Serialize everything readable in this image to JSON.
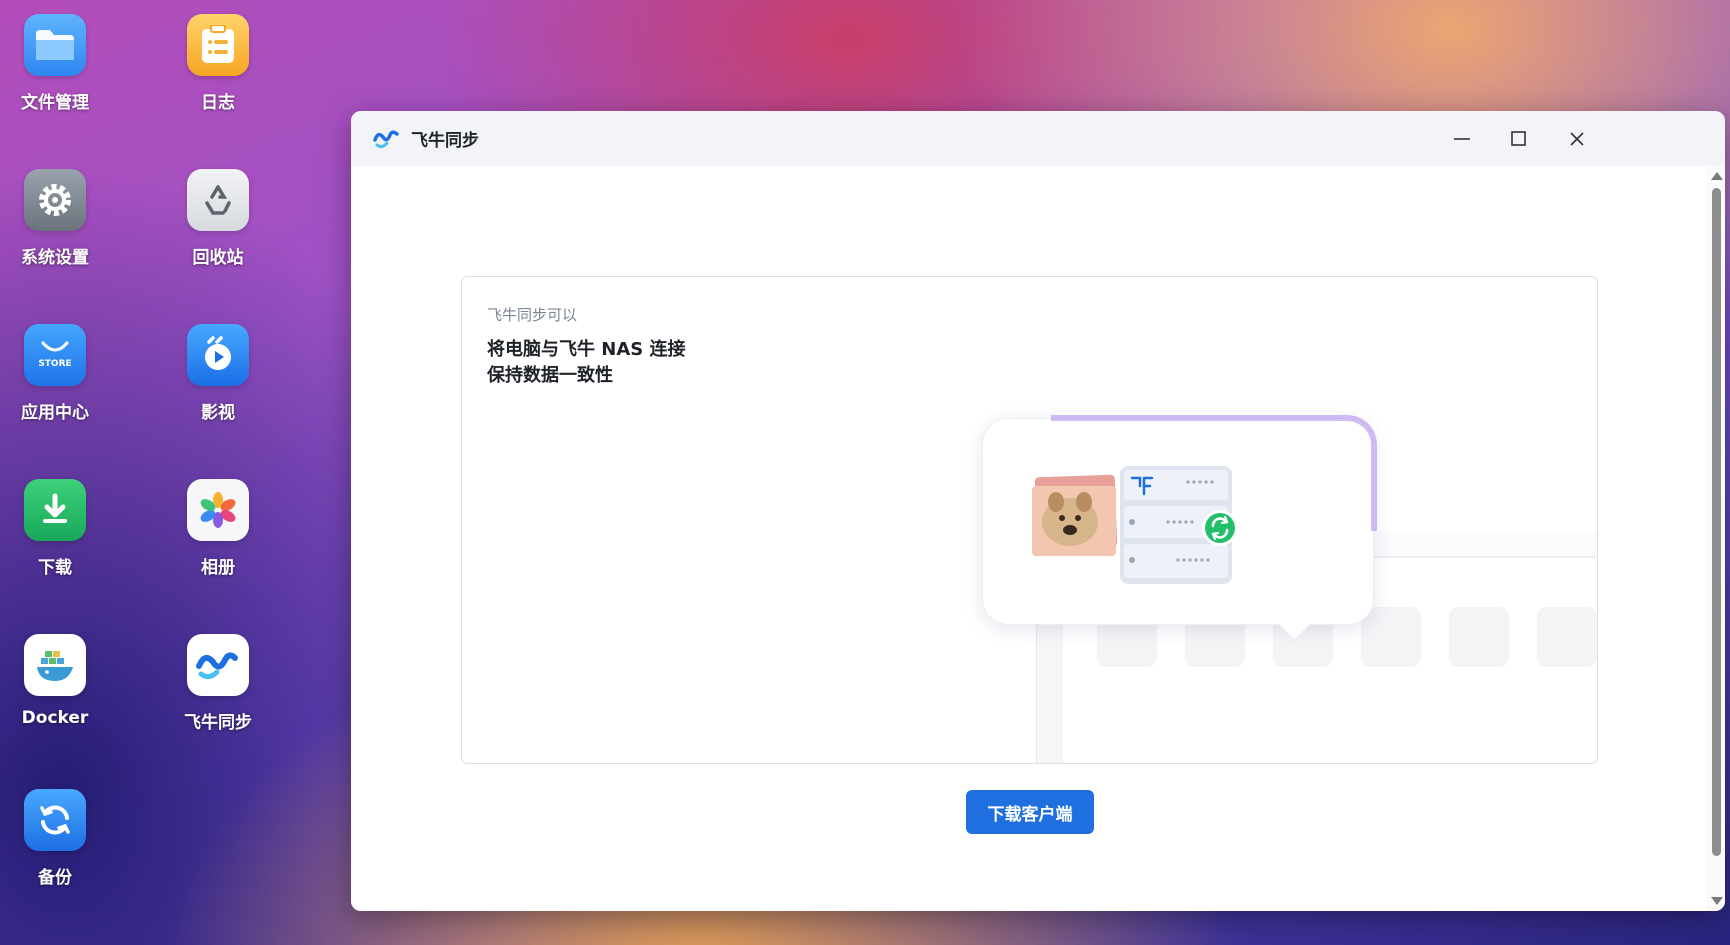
{
  "desktop": {
    "icons": [
      {
        "label": "文件管理",
        "icon": "folder-icon"
      },
      {
        "label": "日志",
        "icon": "log-icon"
      },
      {
        "label": "系统设置",
        "icon": "gear-icon"
      },
      {
        "label": "回收站",
        "icon": "recycle-bin-icon"
      },
      {
        "label": "应用中心",
        "icon": "store-icon",
        "badge_text": "STORE"
      },
      {
        "label": "影视",
        "icon": "video-icon"
      },
      {
        "label": "下载",
        "icon": "download-icon"
      },
      {
        "label": "相册",
        "icon": "photos-icon"
      },
      {
        "label": "Docker",
        "icon": "docker-icon"
      },
      {
        "label": "飞牛同步",
        "icon": "sync-app-icon"
      },
      {
        "label": "备份",
        "icon": "backup-icon"
      }
    ]
  },
  "window": {
    "title": "飞牛同步",
    "controls": [
      "minimize",
      "maximize",
      "close"
    ]
  },
  "main": {
    "intro": {
      "kicker": "飞牛同步可以",
      "line1": "将电脑与飞牛 NAS 连接",
      "line2": "保持数据一致性"
    },
    "download_button": "下载客户端"
  },
  "colors": {
    "accent": "#1f6fe0",
    "sync_green": "#22c06a",
    "title_bar": "#f2f4f8"
  }
}
